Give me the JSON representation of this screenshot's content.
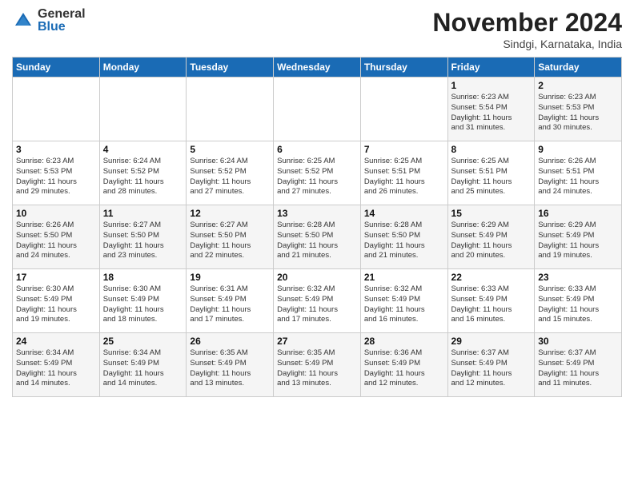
{
  "header": {
    "logo_general": "General",
    "logo_blue": "Blue",
    "month_title": "November 2024",
    "location": "Sindgi, Karnataka, India"
  },
  "weekdays": [
    "Sunday",
    "Monday",
    "Tuesday",
    "Wednesday",
    "Thursday",
    "Friday",
    "Saturday"
  ],
  "weeks": [
    [
      {
        "day": "",
        "info": ""
      },
      {
        "day": "",
        "info": ""
      },
      {
        "day": "",
        "info": ""
      },
      {
        "day": "",
        "info": ""
      },
      {
        "day": "",
        "info": ""
      },
      {
        "day": "1",
        "info": "Sunrise: 6:23 AM\nSunset: 5:54 PM\nDaylight: 11 hours\nand 31 minutes."
      },
      {
        "day": "2",
        "info": "Sunrise: 6:23 AM\nSunset: 5:53 PM\nDaylight: 11 hours\nand 30 minutes."
      }
    ],
    [
      {
        "day": "3",
        "info": "Sunrise: 6:23 AM\nSunset: 5:53 PM\nDaylight: 11 hours\nand 29 minutes."
      },
      {
        "day": "4",
        "info": "Sunrise: 6:24 AM\nSunset: 5:52 PM\nDaylight: 11 hours\nand 28 minutes."
      },
      {
        "day": "5",
        "info": "Sunrise: 6:24 AM\nSunset: 5:52 PM\nDaylight: 11 hours\nand 27 minutes."
      },
      {
        "day": "6",
        "info": "Sunrise: 6:25 AM\nSunset: 5:52 PM\nDaylight: 11 hours\nand 27 minutes."
      },
      {
        "day": "7",
        "info": "Sunrise: 6:25 AM\nSunset: 5:51 PM\nDaylight: 11 hours\nand 26 minutes."
      },
      {
        "day": "8",
        "info": "Sunrise: 6:25 AM\nSunset: 5:51 PM\nDaylight: 11 hours\nand 25 minutes."
      },
      {
        "day": "9",
        "info": "Sunrise: 6:26 AM\nSunset: 5:51 PM\nDaylight: 11 hours\nand 24 minutes."
      }
    ],
    [
      {
        "day": "10",
        "info": "Sunrise: 6:26 AM\nSunset: 5:50 PM\nDaylight: 11 hours\nand 24 minutes."
      },
      {
        "day": "11",
        "info": "Sunrise: 6:27 AM\nSunset: 5:50 PM\nDaylight: 11 hours\nand 23 minutes."
      },
      {
        "day": "12",
        "info": "Sunrise: 6:27 AM\nSunset: 5:50 PM\nDaylight: 11 hours\nand 22 minutes."
      },
      {
        "day": "13",
        "info": "Sunrise: 6:28 AM\nSunset: 5:50 PM\nDaylight: 11 hours\nand 21 minutes."
      },
      {
        "day": "14",
        "info": "Sunrise: 6:28 AM\nSunset: 5:50 PM\nDaylight: 11 hours\nand 21 minutes."
      },
      {
        "day": "15",
        "info": "Sunrise: 6:29 AM\nSunset: 5:49 PM\nDaylight: 11 hours\nand 20 minutes."
      },
      {
        "day": "16",
        "info": "Sunrise: 6:29 AM\nSunset: 5:49 PM\nDaylight: 11 hours\nand 19 minutes."
      }
    ],
    [
      {
        "day": "17",
        "info": "Sunrise: 6:30 AM\nSunset: 5:49 PM\nDaylight: 11 hours\nand 19 minutes."
      },
      {
        "day": "18",
        "info": "Sunrise: 6:30 AM\nSunset: 5:49 PM\nDaylight: 11 hours\nand 18 minutes."
      },
      {
        "day": "19",
        "info": "Sunrise: 6:31 AM\nSunset: 5:49 PM\nDaylight: 11 hours\nand 17 minutes."
      },
      {
        "day": "20",
        "info": "Sunrise: 6:32 AM\nSunset: 5:49 PM\nDaylight: 11 hours\nand 17 minutes."
      },
      {
        "day": "21",
        "info": "Sunrise: 6:32 AM\nSunset: 5:49 PM\nDaylight: 11 hours\nand 16 minutes."
      },
      {
        "day": "22",
        "info": "Sunrise: 6:33 AM\nSunset: 5:49 PM\nDaylight: 11 hours\nand 16 minutes."
      },
      {
        "day": "23",
        "info": "Sunrise: 6:33 AM\nSunset: 5:49 PM\nDaylight: 11 hours\nand 15 minutes."
      }
    ],
    [
      {
        "day": "24",
        "info": "Sunrise: 6:34 AM\nSunset: 5:49 PM\nDaylight: 11 hours\nand 14 minutes."
      },
      {
        "day": "25",
        "info": "Sunrise: 6:34 AM\nSunset: 5:49 PM\nDaylight: 11 hours\nand 14 minutes."
      },
      {
        "day": "26",
        "info": "Sunrise: 6:35 AM\nSunset: 5:49 PM\nDaylight: 11 hours\nand 13 minutes."
      },
      {
        "day": "27",
        "info": "Sunrise: 6:35 AM\nSunset: 5:49 PM\nDaylight: 11 hours\nand 13 minutes."
      },
      {
        "day": "28",
        "info": "Sunrise: 6:36 AM\nSunset: 5:49 PM\nDaylight: 11 hours\nand 12 minutes."
      },
      {
        "day": "29",
        "info": "Sunrise: 6:37 AM\nSunset: 5:49 PM\nDaylight: 11 hours\nand 12 minutes."
      },
      {
        "day": "30",
        "info": "Sunrise: 6:37 AM\nSunset: 5:49 PM\nDaylight: 11 hours\nand 11 minutes."
      }
    ]
  ]
}
